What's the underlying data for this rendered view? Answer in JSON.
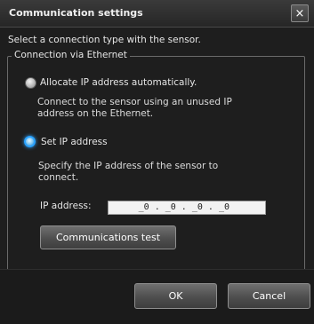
{
  "dialog": {
    "title": "Communication settings",
    "close_symbol": "×",
    "intro": "Select a connection type with the sensor.",
    "group_label": "Connection via Ethernet",
    "options": [
      {
        "label": "Allocate IP address automatically.",
        "description_lines": [
          "Connect to the sensor using an unused IP",
          "address on the Ethernet."
        ],
        "selected": false
      },
      {
        "label": "Set IP address",
        "description_lines": [
          "Specify the IP address of the sensor to",
          "connect."
        ],
        "selected": true
      }
    ],
    "ip_label": "IP address:",
    "ip_value": "_0 . _0 . _0 . _0",
    "comm_test_label": "Communications test",
    "ok_label": "OK",
    "cancel_label": "Cancel",
    "colors": {
      "background": "#1e1e1e",
      "text": "#e6e6e6",
      "radio_selected": "#2aa2ff"
    }
  }
}
